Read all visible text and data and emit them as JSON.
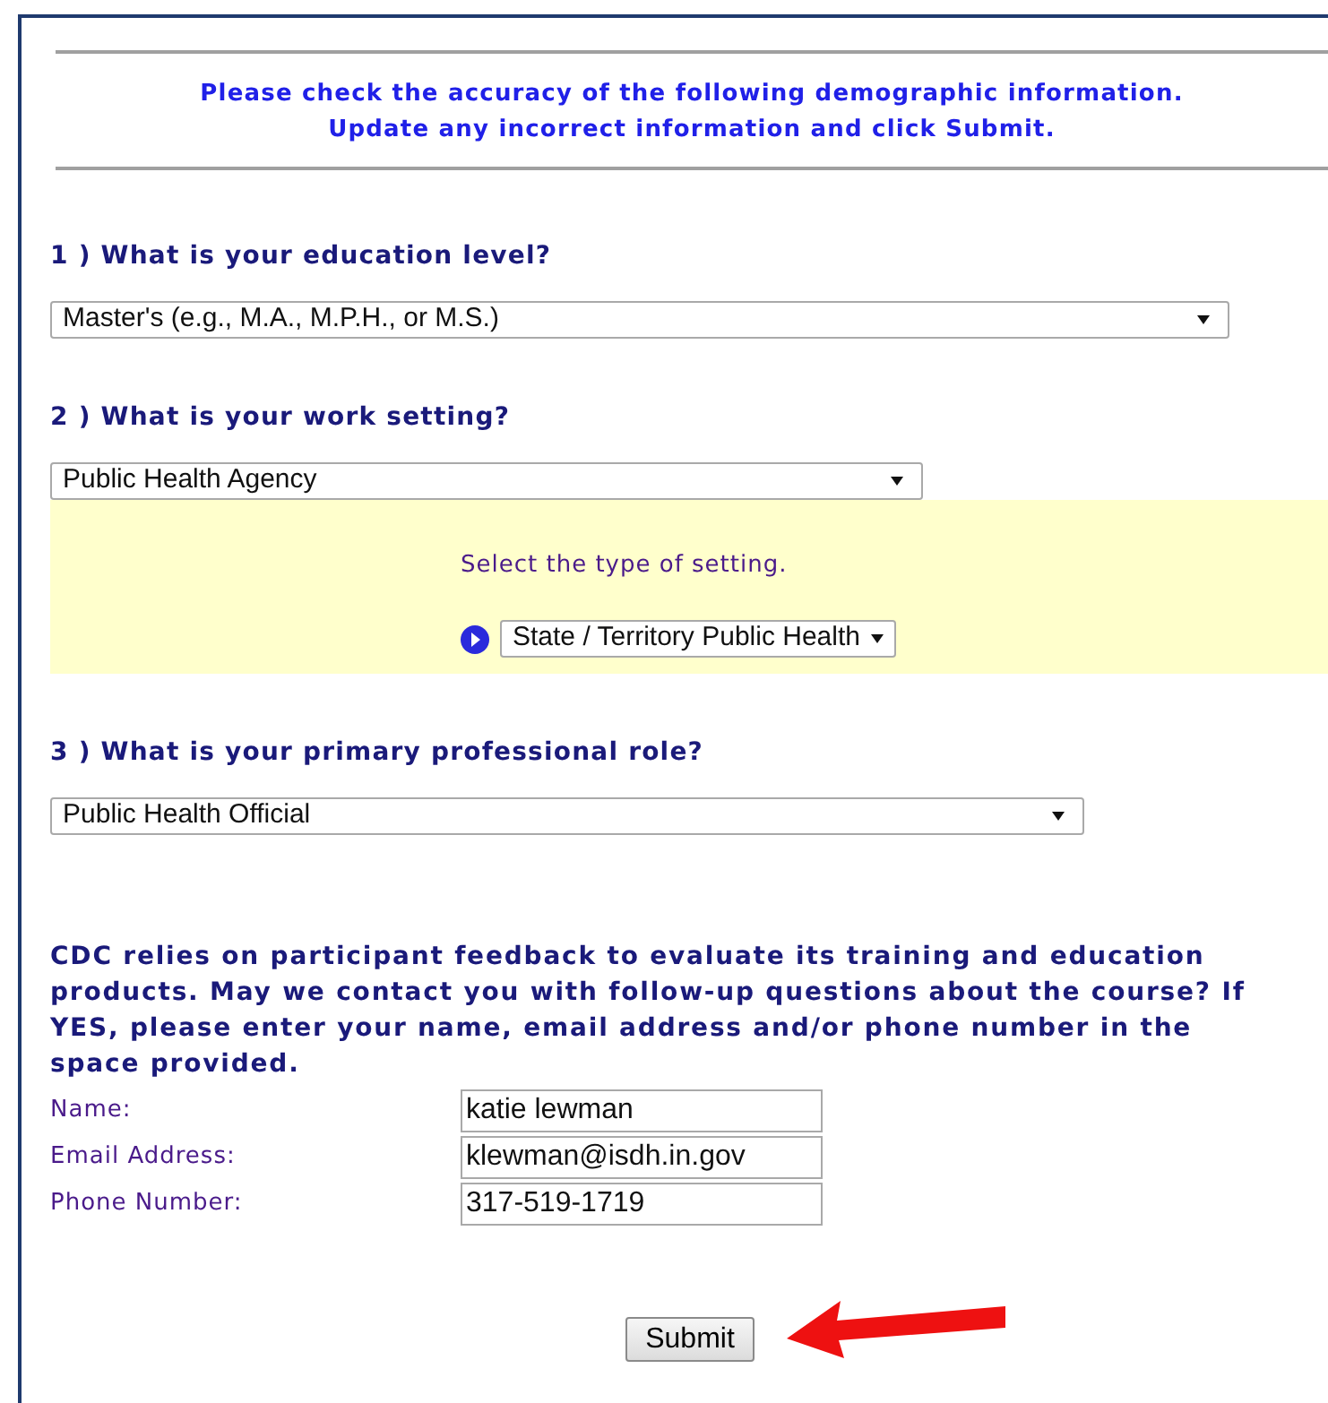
{
  "instructions": "Please check the accuracy of the following demographic information.\nUpdate any incorrect information and click Submit.",
  "questions": [
    {
      "label": "1 ) What is your education level?",
      "value": "Master's (e.g., M.A., M.P.H., or M.S.)"
    },
    {
      "label": "2 ) What is your work setting?",
      "value": "Public Health Agency",
      "followup": {
        "prompt": "Select the type of setting.",
        "value": "State / Territory Public Health"
      }
    },
    {
      "label": "3 ) What is your primary professional role?",
      "value": "Public Health Official"
    }
  ],
  "contact_notice": "CDC relies on participant feedback to evaluate its training and education products. May we contact you with follow-up questions about the course? If YES, please enter your name, email address and/or phone number in the space provided.",
  "contact_fields": [
    {
      "label": "Name:",
      "value": "katie lewman"
    },
    {
      "label": "Email Address:",
      "value": "klewman@isdh.in.gov"
    },
    {
      "label": "Phone Number:",
      "value": "317-519-1719"
    }
  ],
  "submit_button": "Submit"
}
